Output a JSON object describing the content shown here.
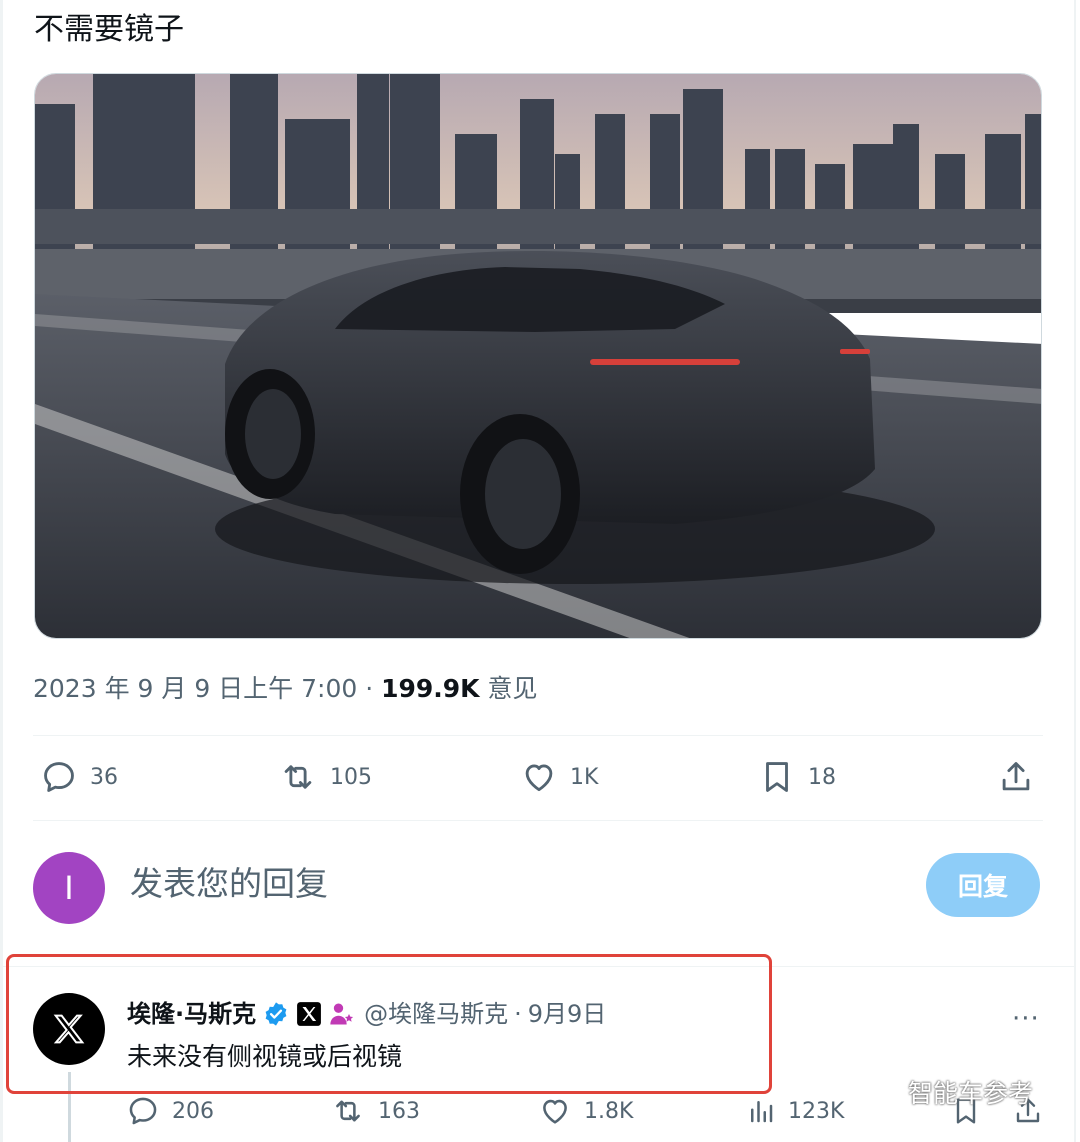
{
  "tweet": {
    "text": "不需要镜子",
    "timestamp": "2023 年 9 月 9 日上午 7:00",
    "separator": " · ",
    "views_count": "199.9K",
    "views_label": " 意见",
    "actions": {
      "replies": "36",
      "retweets": "105",
      "likes": "1K",
      "bookmarks": "18"
    }
  },
  "compose": {
    "avatar_letter": "I",
    "avatar_color": "#a244c2",
    "placeholder": "发表您的回复",
    "button_label": "回复",
    "button_color": "#8ecdf8"
  },
  "reply": {
    "author_name": "埃隆·马斯克",
    "handle": "@埃隆马斯克",
    "separator": "·",
    "date": "9月9日",
    "text": "未来没有侧视镜或后视镜",
    "more": "···",
    "actions": {
      "replies": "206",
      "retweets": "163",
      "likes": "1.8K",
      "views": "123K"
    }
  },
  "watermark": {
    "text": "智能车参考"
  },
  "colors": {
    "secondary_text": "#536471",
    "verified_blue": "#1d9bf0",
    "highlight_red": "#e0433a"
  },
  "icons": [
    "reply-icon",
    "retweet-icon",
    "like-icon",
    "bookmark-icon",
    "share-icon",
    "views-icon",
    "verified-icon",
    "x-logo-icon",
    "more-icon"
  ]
}
